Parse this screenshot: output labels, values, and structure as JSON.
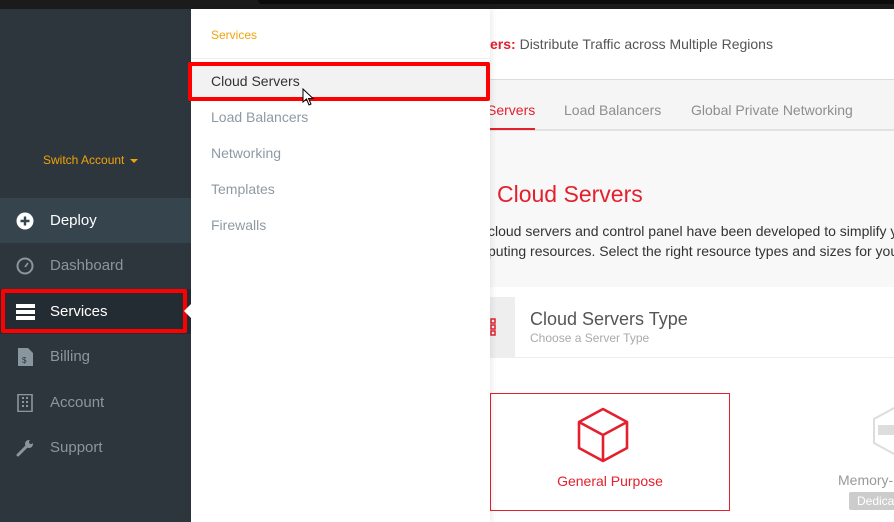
{
  "sidebar": {
    "switch_account": "Switch Account",
    "items": [
      {
        "label": "Deploy",
        "icon": "plus-circle-icon"
      },
      {
        "label": "Dashboard",
        "icon": "gauge-icon"
      },
      {
        "label": "Services",
        "icon": "server-stack-icon"
      },
      {
        "label": "Billing",
        "icon": "invoice-dollar-icon"
      },
      {
        "label": "Account",
        "icon": "building-icon"
      },
      {
        "label": "Support",
        "icon": "wrench-icon"
      }
    ]
  },
  "menu": {
    "title": "Services",
    "items": [
      "Cloud Servers",
      "Load Balancers",
      "Networking",
      "Templates",
      "Firewalls"
    ]
  },
  "main": {
    "banner_bold": "ers:",
    "banner_text": " Distribute Traffic across Multiple Regions",
    "tabs": [
      "Servers",
      "Load Balancers",
      "Global Private Networking"
    ],
    "heading": "Cloud Servers",
    "para1": "cloud servers and control panel have been developed to simplify y",
    "para2": "puting resources. Select the right resource types and sizes for you",
    "card_title": "Cloud Servers Type",
    "card_subtitle": "Choose a Server Type",
    "option1": "General Purpose",
    "option2": "Memory-",
    "option2_badge": "Dedica"
  },
  "colors": {
    "accent": "#e4202e",
    "highlight": "#ff0000",
    "sidebar": "#2d363c",
    "orange": "#f0a30a"
  }
}
